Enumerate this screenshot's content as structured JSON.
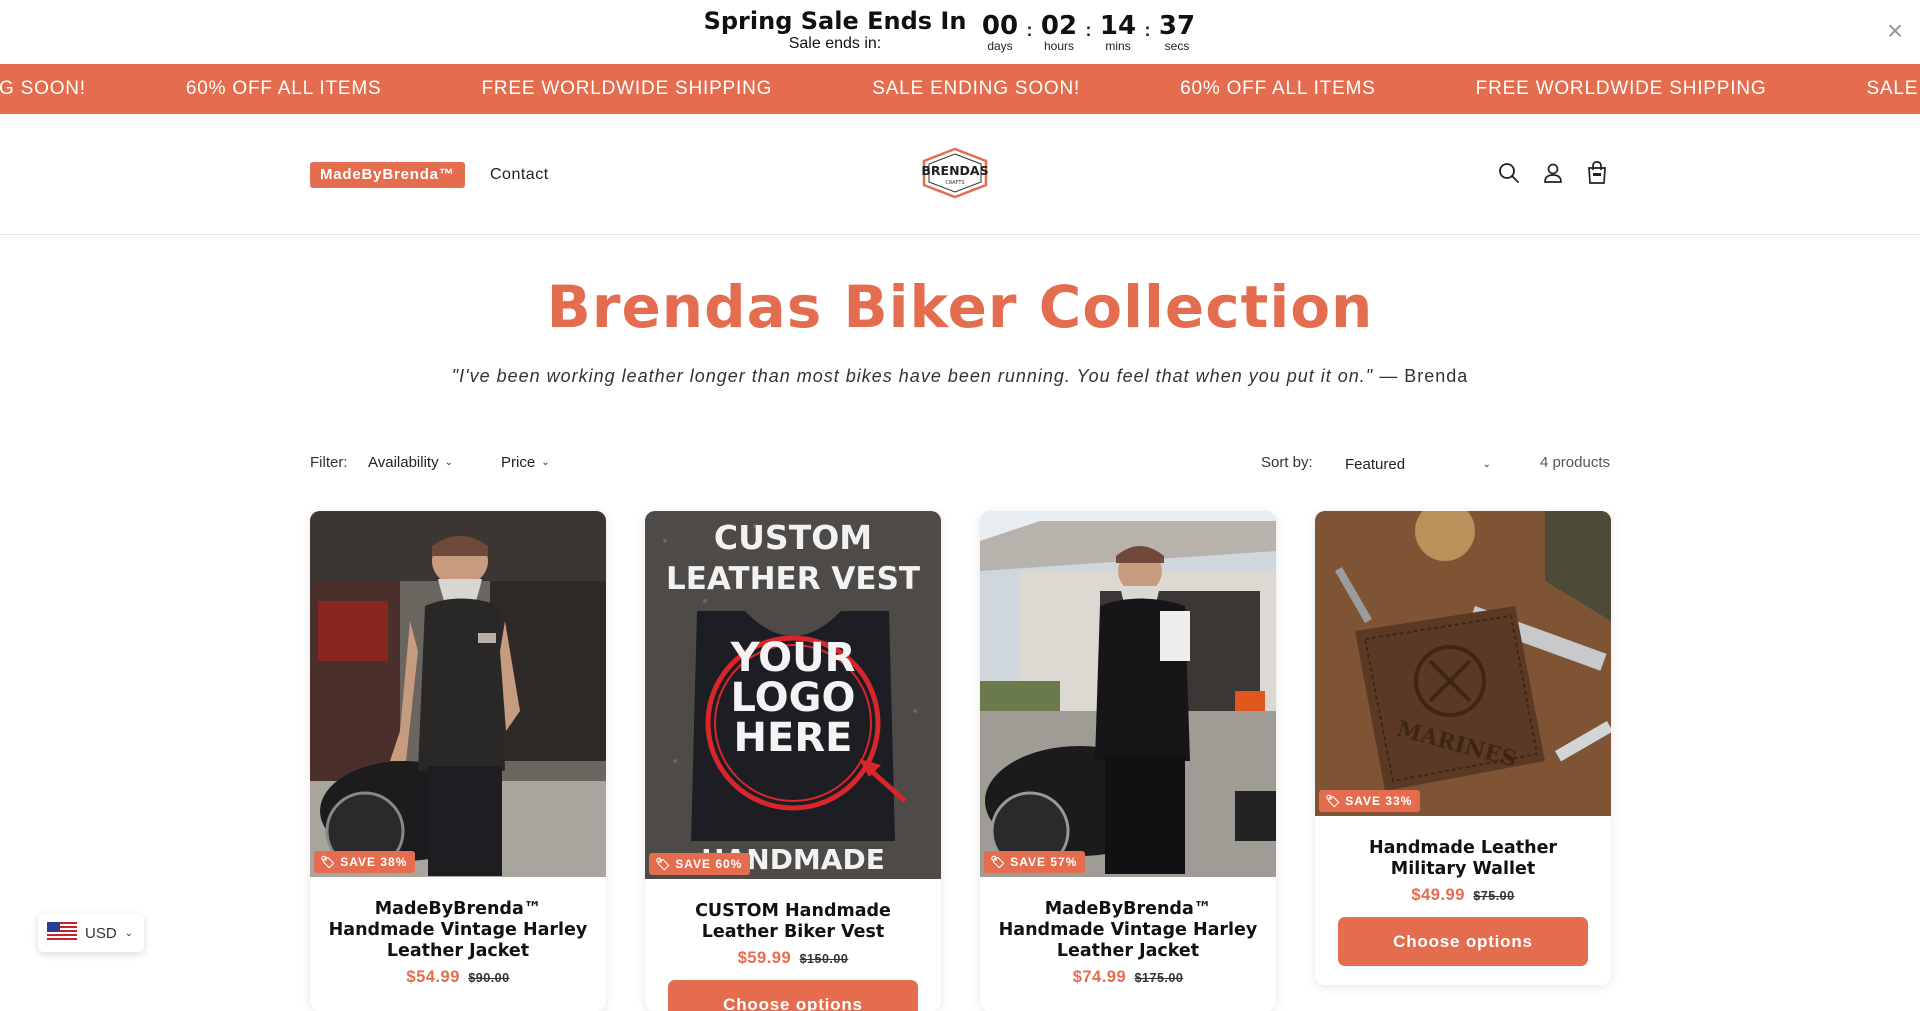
{
  "announcement": {
    "title": "Spring Sale Ends In",
    "subtitle": "Sale ends in:",
    "countdown": [
      {
        "value": "00",
        "label": "days"
      },
      {
        "value": "02",
        "label": "hours"
      },
      {
        "value": "14",
        "label": "mins"
      },
      {
        "value": "37",
        "label": "secs"
      }
    ],
    "close_icon": "close-icon"
  },
  "marquee": {
    "items": [
      "SALE ENDING SOON!",
      "60% OFF ALL ITEMS",
      "FREE WORLDWIDE SHIPPING",
      "SALE ENDING SOON!",
      "60% OFF ALL ITEMS",
      "FREE WORLDWIDE SHIPPING",
      "SALE ENDING SOON!"
    ],
    "color": "#e56d4f"
  },
  "header": {
    "brand_link": "MadeByBrenda™",
    "contact_link": "Contact",
    "logo_text_1": "BRENDAS",
    "logo_text_2": "CRAFTS",
    "icons": [
      "search-icon",
      "account-icon",
      "cart-icon"
    ]
  },
  "collection": {
    "title": "Brendas Biker Collection",
    "quote": "\"I've been working leather longer than most bikes have been running. You feel that when you put it on.\"",
    "quote_author": "— Brenda"
  },
  "filters": {
    "filter_label": "Filter:",
    "availability": "Availability",
    "price": "Price",
    "sort_label": "Sort by:",
    "sort_value": "Featured",
    "count": "4 products"
  },
  "products": [
    {
      "title": "MadeByBrenda™ Handmade Vintage Harley Leather Jacket",
      "save": "SAVE 38%",
      "price": "$54.99",
      "compare_price": "$90.00"
    },
    {
      "title": "CUSTOM Handmade Leather Biker Vest",
      "save": "SAVE 60%",
      "price": "$59.99",
      "compare_price": "$150.00",
      "image_text": [
        "CUSTOM",
        "LEATHER VEST",
        "YOUR",
        "LOGO",
        "HERE",
        "HANDMADE"
      ],
      "button": "Choose options"
    },
    {
      "title": "MadeByBrenda™ Handmade Vintage Harley Leather Jacket",
      "save": "SAVE 57%",
      "price": "$74.99",
      "compare_price": "$175.00"
    },
    {
      "title": "Handmade Leather Military Wallet",
      "save": "SAVE 33%",
      "price": "$49.99",
      "compare_price": "$75.00",
      "image_text": "MARINES",
      "button": "Choose options"
    }
  ],
  "currency": {
    "code": "USD",
    "flag": "us-flag-icon"
  },
  "colors": {
    "accent": "#e56d4f"
  }
}
